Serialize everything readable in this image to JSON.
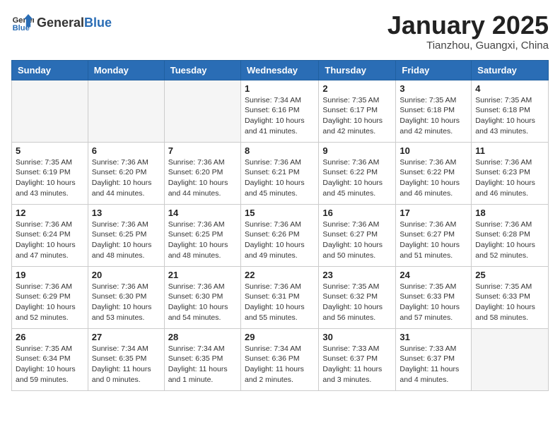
{
  "header": {
    "logo_general": "General",
    "logo_blue": "Blue",
    "month": "January 2025",
    "location": "Tianzhou, Guangxi, China"
  },
  "days_of_week": [
    "Sunday",
    "Monday",
    "Tuesday",
    "Wednesday",
    "Thursday",
    "Friday",
    "Saturday"
  ],
  "weeks": [
    [
      {
        "day": "",
        "info": ""
      },
      {
        "day": "",
        "info": ""
      },
      {
        "day": "",
        "info": ""
      },
      {
        "day": "1",
        "info": "Sunrise: 7:34 AM\nSunset: 6:16 PM\nDaylight: 10 hours\nand 41 minutes."
      },
      {
        "day": "2",
        "info": "Sunrise: 7:35 AM\nSunset: 6:17 PM\nDaylight: 10 hours\nand 42 minutes."
      },
      {
        "day": "3",
        "info": "Sunrise: 7:35 AM\nSunset: 6:18 PM\nDaylight: 10 hours\nand 42 minutes."
      },
      {
        "day": "4",
        "info": "Sunrise: 7:35 AM\nSunset: 6:18 PM\nDaylight: 10 hours\nand 43 minutes."
      }
    ],
    [
      {
        "day": "5",
        "info": "Sunrise: 7:35 AM\nSunset: 6:19 PM\nDaylight: 10 hours\nand 43 minutes."
      },
      {
        "day": "6",
        "info": "Sunrise: 7:36 AM\nSunset: 6:20 PM\nDaylight: 10 hours\nand 44 minutes."
      },
      {
        "day": "7",
        "info": "Sunrise: 7:36 AM\nSunset: 6:20 PM\nDaylight: 10 hours\nand 44 minutes."
      },
      {
        "day": "8",
        "info": "Sunrise: 7:36 AM\nSunset: 6:21 PM\nDaylight: 10 hours\nand 45 minutes."
      },
      {
        "day": "9",
        "info": "Sunrise: 7:36 AM\nSunset: 6:22 PM\nDaylight: 10 hours\nand 45 minutes."
      },
      {
        "day": "10",
        "info": "Sunrise: 7:36 AM\nSunset: 6:22 PM\nDaylight: 10 hours\nand 46 minutes."
      },
      {
        "day": "11",
        "info": "Sunrise: 7:36 AM\nSunset: 6:23 PM\nDaylight: 10 hours\nand 46 minutes."
      }
    ],
    [
      {
        "day": "12",
        "info": "Sunrise: 7:36 AM\nSunset: 6:24 PM\nDaylight: 10 hours\nand 47 minutes."
      },
      {
        "day": "13",
        "info": "Sunrise: 7:36 AM\nSunset: 6:25 PM\nDaylight: 10 hours\nand 48 minutes."
      },
      {
        "day": "14",
        "info": "Sunrise: 7:36 AM\nSunset: 6:25 PM\nDaylight: 10 hours\nand 48 minutes."
      },
      {
        "day": "15",
        "info": "Sunrise: 7:36 AM\nSunset: 6:26 PM\nDaylight: 10 hours\nand 49 minutes."
      },
      {
        "day": "16",
        "info": "Sunrise: 7:36 AM\nSunset: 6:27 PM\nDaylight: 10 hours\nand 50 minutes."
      },
      {
        "day": "17",
        "info": "Sunrise: 7:36 AM\nSunset: 6:27 PM\nDaylight: 10 hours\nand 51 minutes."
      },
      {
        "day": "18",
        "info": "Sunrise: 7:36 AM\nSunset: 6:28 PM\nDaylight: 10 hours\nand 52 minutes."
      }
    ],
    [
      {
        "day": "19",
        "info": "Sunrise: 7:36 AM\nSunset: 6:29 PM\nDaylight: 10 hours\nand 52 minutes."
      },
      {
        "day": "20",
        "info": "Sunrise: 7:36 AM\nSunset: 6:30 PM\nDaylight: 10 hours\nand 53 minutes."
      },
      {
        "day": "21",
        "info": "Sunrise: 7:36 AM\nSunset: 6:30 PM\nDaylight: 10 hours\nand 54 minutes."
      },
      {
        "day": "22",
        "info": "Sunrise: 7:36 AM\nSunset: 6:31 PM\nDaylight: 10 hours\nand 55 minutes."
      },
      {
        "day": "23",
        "info": "Sunrise: 7:35 AM\nSunset: 6:32 PM\nDaylight: 10 hours\nand 56 minutes."
      },
      {
        "day": "24",
        "info": "Sunrise: 7:35 AM\nSunset: 6:33 PM\nDaylight: 10 hours\nand 57 minutes."
      },
      {
        "day": "25",
        "info": "Sunrise: 7:35 AM\nSunset: 6:33 PM\nDaylight: 10 hours\nand 58 minutes."
      }
    ],
    [
      {
        "day": "26",
        "info": "Sunrise: 7:35 AM\nSunset: 6:34 PM\nDaylight: 10 hours\nand 59 minutes."
      },
      {
        "day": "27",
        "info": "Sunrise: 7:34 AM\nSunset: 6:35 PM\nDaylight: 11 hours\nand 0 minutes."
      },
      {
        "day": "28",
        "info": "Sunrise: 7:34 AM\nSunset: 6:35 PM\nDaylight: 11 hours\nand 1 minute."
      },
      {
        "day": "29",
        "info": "Sunrise: 7:34 AM\nSunset: 6:36 PM\nDaylight: 11 hours\nand 2 minutes."
      },
      {
        "day": "30",
        "info": "Sunrise: 7:33 AM\nSunset: 6:37 PM\nDaylight: 11 hours\nand 3 minutes."
      },
      {
        "day": "31",
        "info": "Sunrise: 7:33 AM\nSunset: 6:37 PM\nDaylight: 11 hours\nand 4 minutes."
      },
      {
        "day": "",
        "info": ""
      }
    ]
  ]
}
